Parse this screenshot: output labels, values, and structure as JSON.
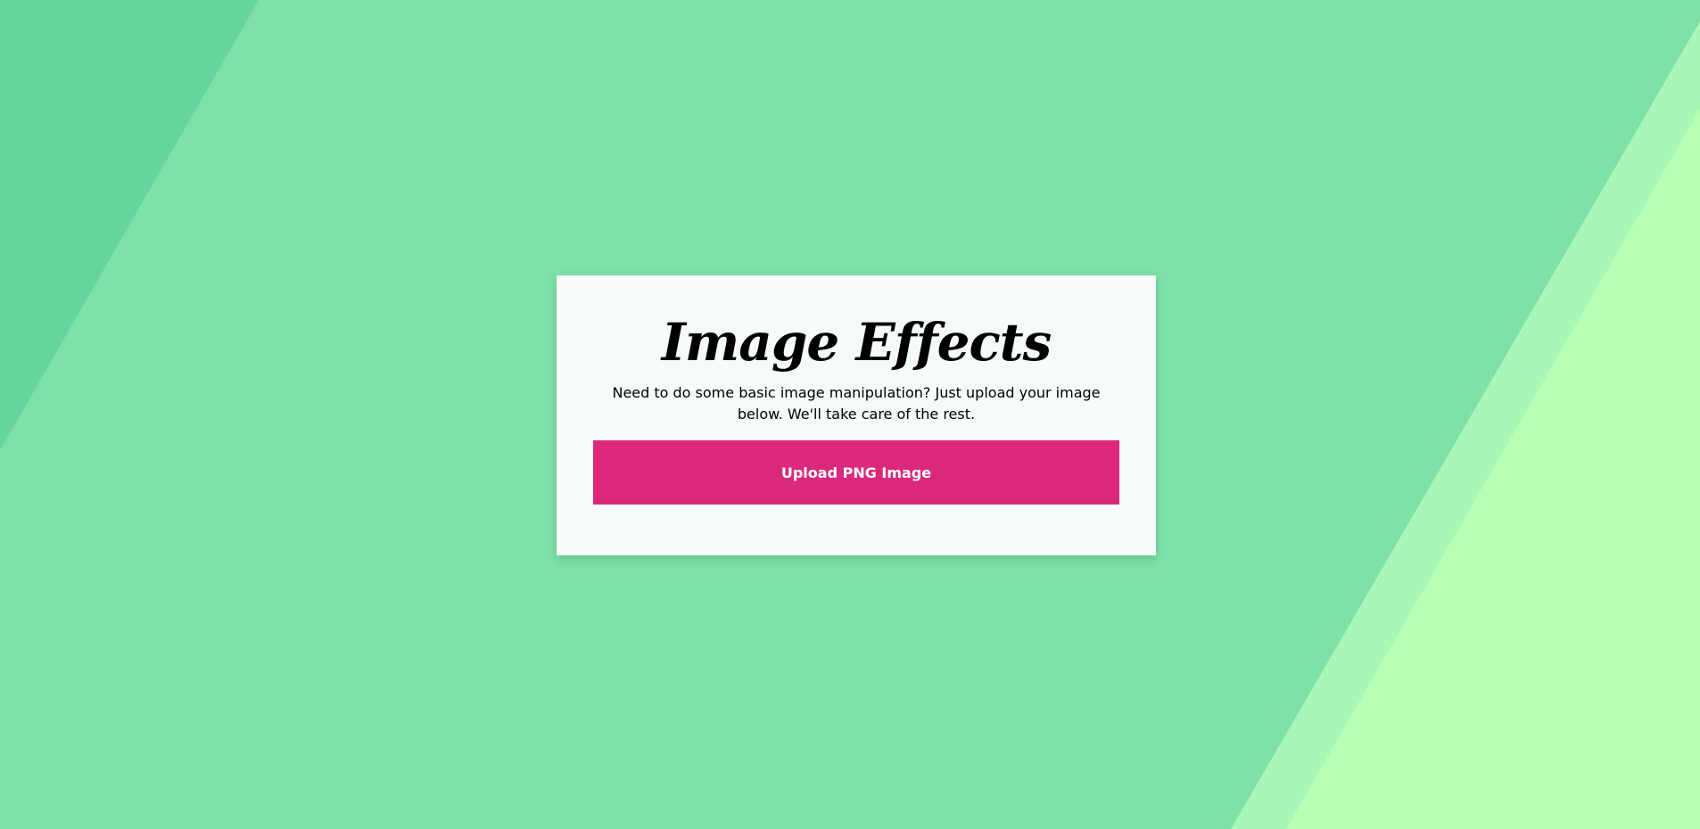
{
  "colors": {
    "background_main": "#7fe0a8",
    "background_left_stripe": "#66d49f",
    "background_right_stripe_1": "#a9f7b6",
    "background_right_stripe_2": "#b7ffb6",
    "card_background": "#f5fafa",
    "button_background": "#dc287b",
    "button_text": "#ffffff"
  },
  "card": {
    "title": "Image Effects",
    "description": "Need to do some basic image manipulation? Just upload your image below. We'll take care of the rest.",
    "upload_button_label": "Upload PNG Image"
  }
}
